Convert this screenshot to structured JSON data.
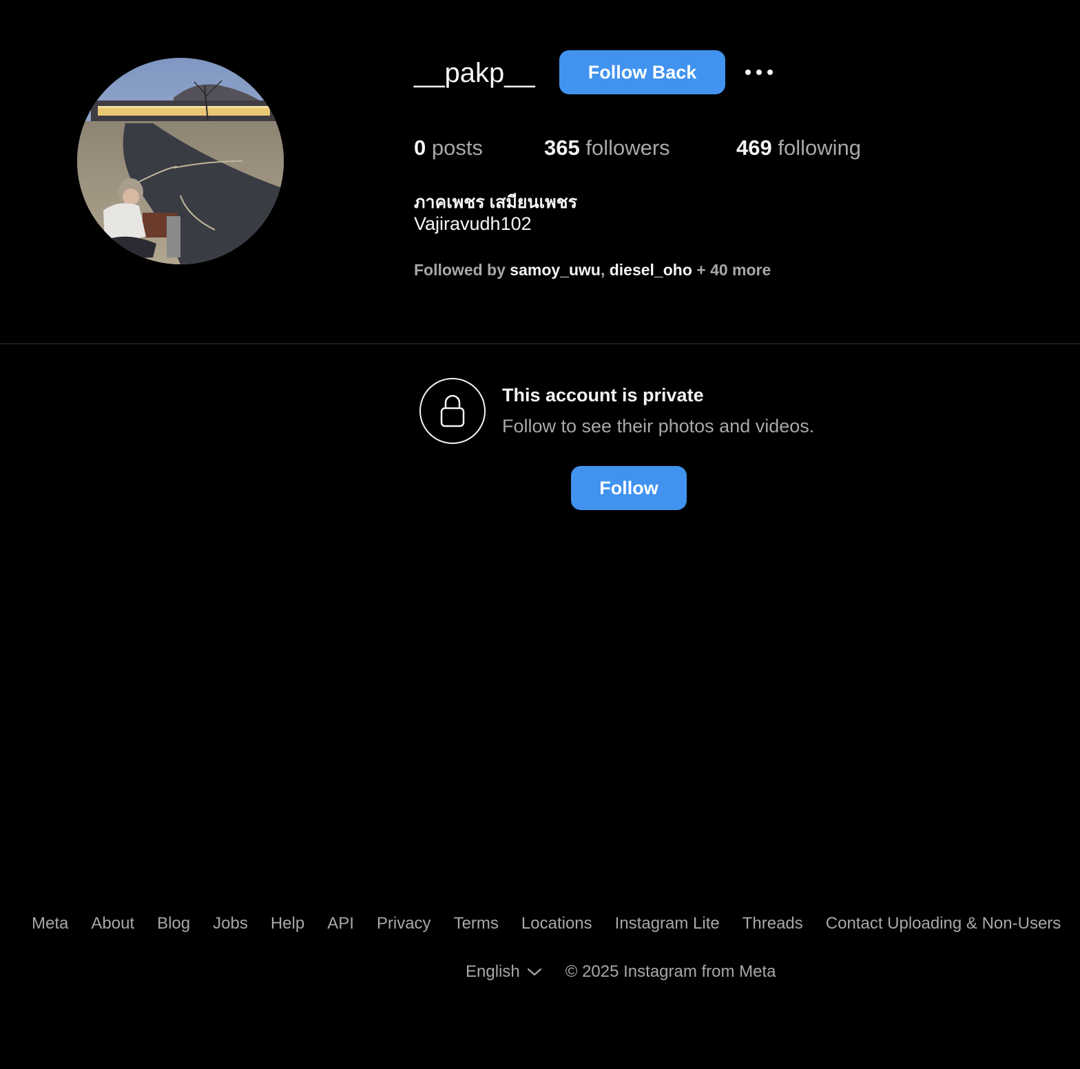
{
  "profile": {
    "username": "__pakp__",
    "follow_back_label": "Follow Back",
    "more_icon": "more-horizontal-icon",
    "stats": {
      "posts_count": "0",
      "posts_label": "posts",
      "followers_count": "365",
      "followers_label": "followers",
      "following_count": "469",
      "following_label": "following"
    },
    "full_name": "ภาคเพชร เสมียนเพชร",
    "bio": "Vajiravudh102",
    "followed_by": {
      "prefix": "Followed by ",
      "users": [
        "samoy_uwu",
        "diesel_oho"
      ],
      "separator": ", ",
      "suffix": " + 40 more"
    }
  },
  "private_notice": {
    "icon": "lock-icon",
    "title": "This account is private",
    "subtitle": "Follow to see their photos and videos.",
    "follow_label": "Follow"
  },
  "footer": {
    "links": [
      "Meta",
      "About",
      "Blog",
      "Jobs",
      "Help",
      "API",
      "Privacy",
      "Terms",
      "Locations",
      "Instagram Lite",
      "Threads",
      "Contact Uploading & Non-Users"
    ],
    "language": "English",
    "copyright": "© 2025 Instagram from Meta"
  },
  "colors": {
    "background": "#000000",
    "primary_button": "#4193ef",
    "text_primary": "#f5f5f5",
    "text_secondary": "#a8a8a8",
    "divider": "#363636"
  }
}
